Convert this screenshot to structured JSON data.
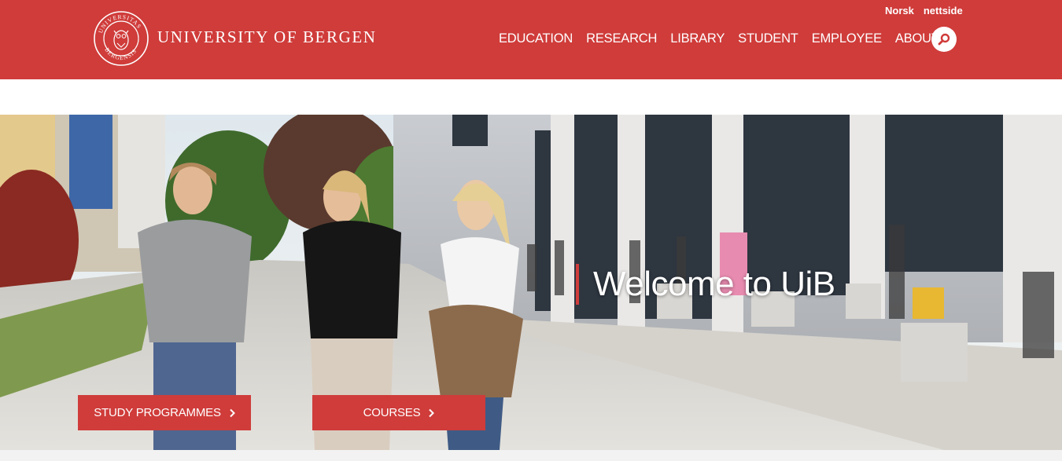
{
  "header": {
    "logo_text": "UNIVERSITY OF BERGEN",
    "seal_text": "UNIVERSITAS BERGENSIS",
    "lang_links": [
      "Norsk",
      "nettside"
    ],
    "nav": [
      {
        "label": "EDUCATION"
      },
      {
        "label": "RESEARCH"
      },
      {
        "label": "LIBRARY"
      },
      {
        "label": "STUDENT"
      },
      {
        "label": "EMPLOYEE"
      },
      {
        "label": "ABOUT",
        "has_dropdown": true
      }
    ],
    "search_icon": "search-icon"
  },
  "hero": {
    "title": "Welcome to UiB",
    "buttons": [
      {
        "label": "STUDY PROGRAMMES"
      },
      {
        "label": "COURSES"
      }
    ]
  },
  "colors": {
    "brand": "#cf3c3a",
    "white": "#ffffff"
  }
}
